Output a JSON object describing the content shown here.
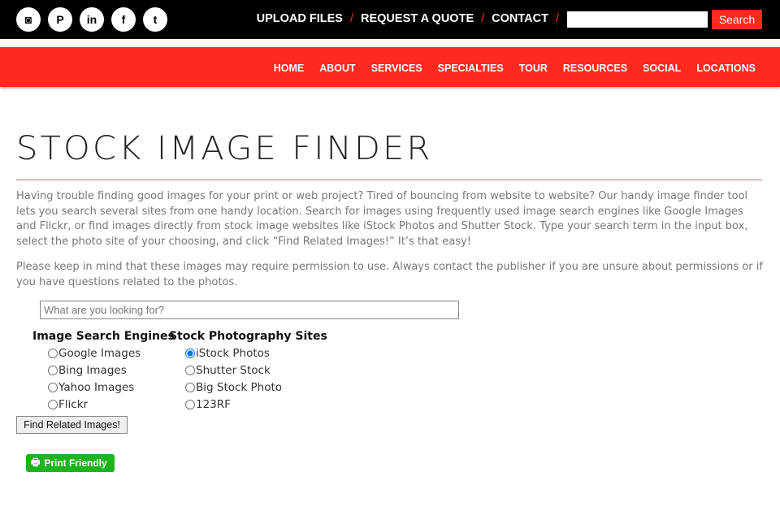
{
  "header": {
    "social": [
      "instagram",
      "pinterest",
      "linkedin",
      "facebook",
      "twitter"
    ],
    "links": [
      "UPLOAD FILES",
      "REQUEST A QUOTE",
      "CONTACT"
    ],
    "separator": "/",
    "search_button": "Search"
  },
  "nav": [
    "HOME",
    "ABOUT",
    "SERVICES",
    "SPECIALTIES",
    "TOUR",
    "RESOURCES",
    "SOCIAL",
    "LOCATIONS"
  ],
  "page": {
    "title": "STOCK IMAGE FINDER",
    "intro": "Having trouble finding good images for your print or web project? Tired of bouncing from website to website? Our handy image finder tool lets you search several sites from one handy location. Search for images using frequently used image search engines like Google Images and Flickr, or find images directly from stock image websites like iStock Photos and Shutter Stock. Type your search term in the input box, select the photo site of your choosing, and click “Find Related Images!” It’s that easy!",
    "note": "Please keep in mind that these images may require permission to use. Always contact the publisher if you are unsure about permissions or if you have questions related to the photos.",
    "search_placeholder": "What are you looking for?",
    "engines_heading": "Image Search Engines",
    "engines": [
      "Google Images",
      "Bing Images",
      "Yahoo Images",
      "Flickr"
    ],
    "stock_heading": "Stock Photography Sites",
    "stock": [
      "iStock Photos",
      "Shutter Stock",
      "Big Stock Photo",
      "123RF"
    ],
    "selected": "iStock Photos",
    "find_button": "Find Related Images!",
    "print_button": "Print Friendly"
  },
  "colors": {
    "accent": "#ff2a1f",
    "print": "#1db31d"
  }
}
